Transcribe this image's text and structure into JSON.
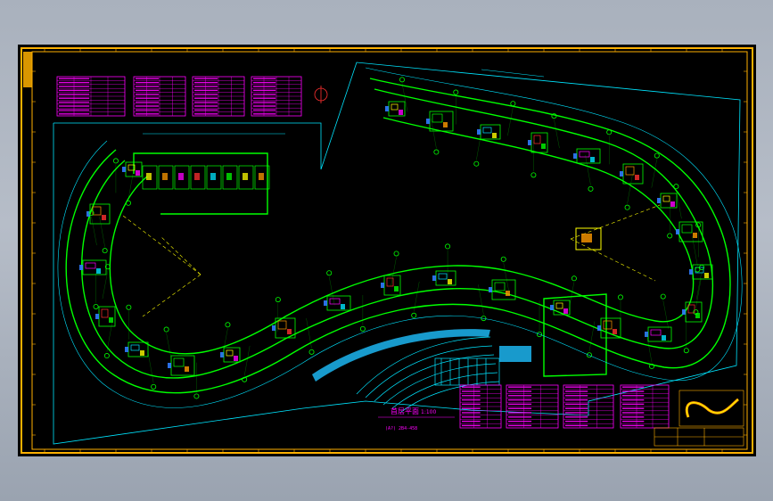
{
  "drawing": {
    "plan_title": "首层平面",
    "plan_scale": "1:100",
    "plan_note": "(A?) 2B4-458"
  },
  "colors": {
    "background": "#000000",
    "frame": "#ffb000",
    "wall": "#00ff00",
    "axis": "#00e5ff",
    "table": "#ff00ff",
    "accent_yellow": "#ffff00",
    "accent_orange": "#ff9a00",
    "accent_red": "#ff3030",
    "accent_blue": "#2f7bff"
  },
  "schedule_tables": {
    "top_count": 4,
    "bottom_count": 4
  }
}
